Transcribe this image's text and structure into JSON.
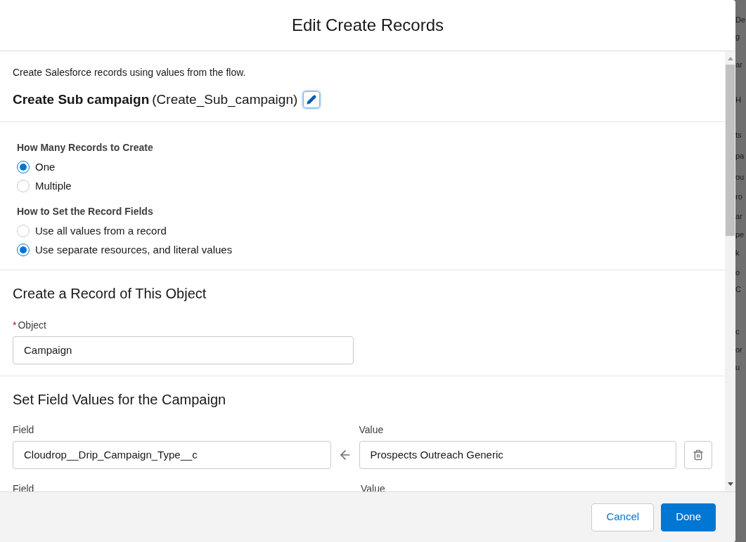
{
  "modal": {
    "title": "Edit Create Records"
  },
  "intro": {
    "description": "Create Salesforce records using values from the flow.",
    "element_label": "Create Sub campaign",
    "api_name": "(Create_Sub_campaign)"
  },
  "radio_groups": [
    {
      "label": "How Many Records to Create",
      "options": [
        {
          "label": "One",
          "selected": true
        },
        {
          "label": "Multiple",
          "selected": false
        }
      ]
    },
    {
      "label": "How to Set the Record Fields",
      "options": [
        {
          "label": "Use all values from a record",
          "selected": false
        },
        {
          "label": "Use separate resources, and literal values",
          "selected": true
        }
      ]
    }
  ],
  "object_section": {
    "heading": "Create a Record of This Object",
    "field": {
      "required_mark": "*",
      "label": "Object",
      "value": "Campaign"
    }
  },
  "field_values_section": {
    "heading": "Set Field Values for the Campaign",
    "rows": [
      {
        "field_label": "Field",
        "field_value": "Cloudrop__Drip_Campaign_Type__c",
        "value_label": "Value",
        "value": "Prospects Outreach Generic"
      },
      {
        "field_label": "Field",
        "value_label": "Value"
      }
    ]
  },
  "footer": {
    "buttons": [
      {
        "label": "Cancel",
        "kind": "neutral"
      },
      {
        "label": "Done",
        "kind": "brand"
      }
    ]
  },
  "background_fragments": [
    "De",
    "g",
    "ar",
    "H",
    "ts",
    "pa",
    "ou",
    "ro",
    "ar",
    "pe",
    "k",
    "o",
    "C",
    "c",
    "or",
    "u"
  ]
}
